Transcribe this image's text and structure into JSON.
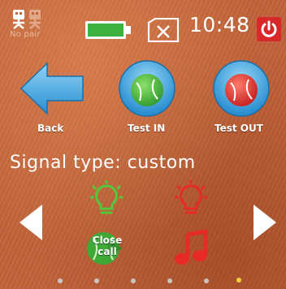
{
  "status_bar": {
    "pair_status": "No pair",
    "clock": "10:48",
    "icons": [
      "pair-icon",
      "battery-icon",
      "sd-card-icon",
      "power-icon"
    ]
  },
  "buttons": {
    "back_label": "Back",
    "test_in_label": "Test IN",
    "test_out_label": "Test OUT"
  },
  "signal": {
    "label": "Signal type: custom",
    "close_call_label": "Close call",
    "icons": [
      "light-in-icon",
      "light-out-icon",
      "close-call-icon",
      "music-note-icon"
    ],
    "page_count": 6,
    "active_page": 6
  },
  "colors": {
    "background": "#c2643a",
    "accent_blue": "#3aa8e6",
    "in_green": "#46b43a",
    "out_red": "#e02828",
    "power_red": "#d9282a",
    "active_dot": "#f2d23c"
  }
}
